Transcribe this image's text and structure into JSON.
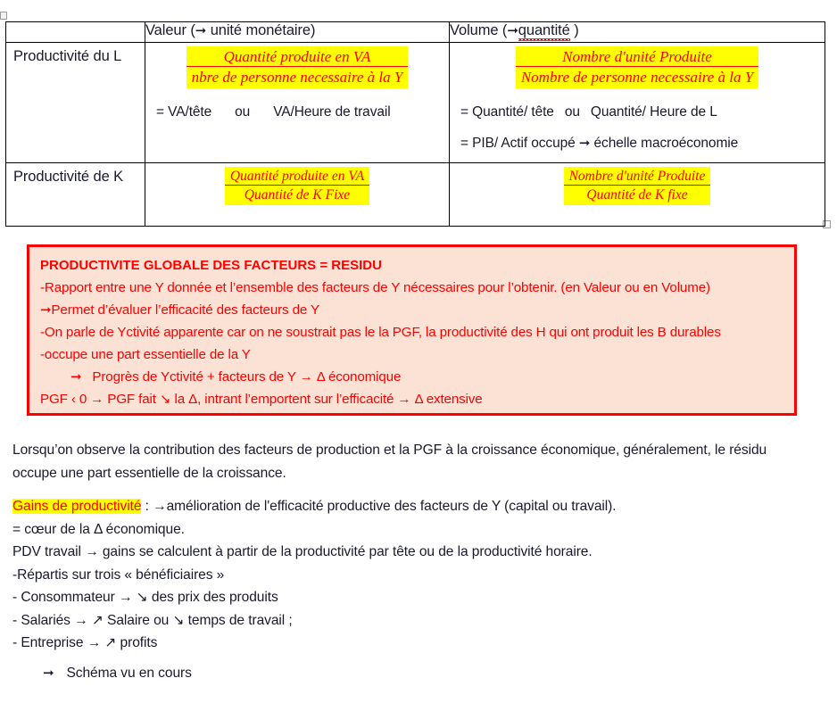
{
  "table": {
    "headers": [
      "",
      "Valeur (→ unité monétaire)",
      "Volume (→quantité )"
    ],
    "header_valeur_pre": "Valeur (",
    "header_valeur_post": " unité monétaire)",
    "header_volume_pre": "Volume (",
    "header_volume_post": "quantité",
    "header_volume_end": " )",
    "rows": [
      {
        "label": "Productivité du L",
        "valeur": {
          "fraction_num": "Quantité produite en VA",
          "fraction_den": "nbre de personne necessaire à la Y",
          "line1_a": "= VA/tête",
          "line1_ou": "ou",
          "line1_b": "VA/Heure de travail"
        },
        "volume": {
          "fraction_num": "Nombre d'unité Produite",
          "fraction_den": "Nombre de personne necessaire à la Y",
          "line1_a": "= Quantité/ tête",
          "line1_ou": "ou",
          "line1_b": "Quantité/ Heure de L",
          "line2_a": "= PIB/ Actif occupé",
          "line2_b": " échelle macroéconomie"
        }
      },
      {
        "label": "Productivité de K",
        "valeur": {
          "fraction_num": "Quantité produite en VA",
          "fraction_den": "Quantité de K Fixe"
        },
        "volume": {
          "fraction_num": "Nombre d'unité Produite",
          "fraction_den": "Quantité de K fixe"
        }
      }
    ]
  },
  "callout": {
    "title": "PRODUCTIVITE GLOBALE DES FACTEURS = RESIDU",
    "line1": "-Rapport entre une Y donnée et l’ensemble des facteurs de Y nécessaires pour l’obtenir. (en Valeur ou en Volume)",
    "line2_arrow": "→",
    "line2": "Permet d’évaluer l’efficacité des facteurs de Y",
    "line3": "-On parle de Yctivité apparente car on ne soustrait pas le la PGF, la productivité des H qui ont produit les B durables",
    "line4": "-occupe une part essentielle de la Y",
    "line5_arrow": "→",
    "line5": "Progrès de Yctivité + facteurs de Y → Δ économique",
    "line6": "PGF ‹ 0 → PGF fait ↘ la Δ, intrant l’emportent sur l’efficacité → Δ extensive"
  },
  "body": {
    "para1_line1": "Lorsqu’on observe la contribution des facteurs de production et la PGF à la croissance économique, généralement, le résidu",
    "para1_line2": "occupe une part essentielle de la croissance.",
    "gains_label": "Gains de productivité",
    "gains_rest": " : →amélioration de l'efficacité productive des facteurs de Y (capital ou travail).",
    "line_coeur": "= cœur de la Δ économique.",
    "line_pdv": "PDV travail → gains se calculent à partir de la productivité par tête ou de la productivité horaire.",
    "line_repartis": "-Répartis sur trois « bénéficiaires »",
    "line_conso": "- Consommateur → ↘ des prix des produits",
    "line_salaries": "-  Salariés → ↗  Salaire ou ↘ temps de travail ;",
    "line_entreprise": "- Entreprise → ↗ profits",
    "schema_arrow": "→",
    "schema_text": "Schéma vu en cours"
  },
  "colors": {
    "highlight": "#ffff00",
    "accent_red": "#ff0000",
    "callout_bg": "#fbe2d5",
    "text": "#1a1a2e"
  }
}
